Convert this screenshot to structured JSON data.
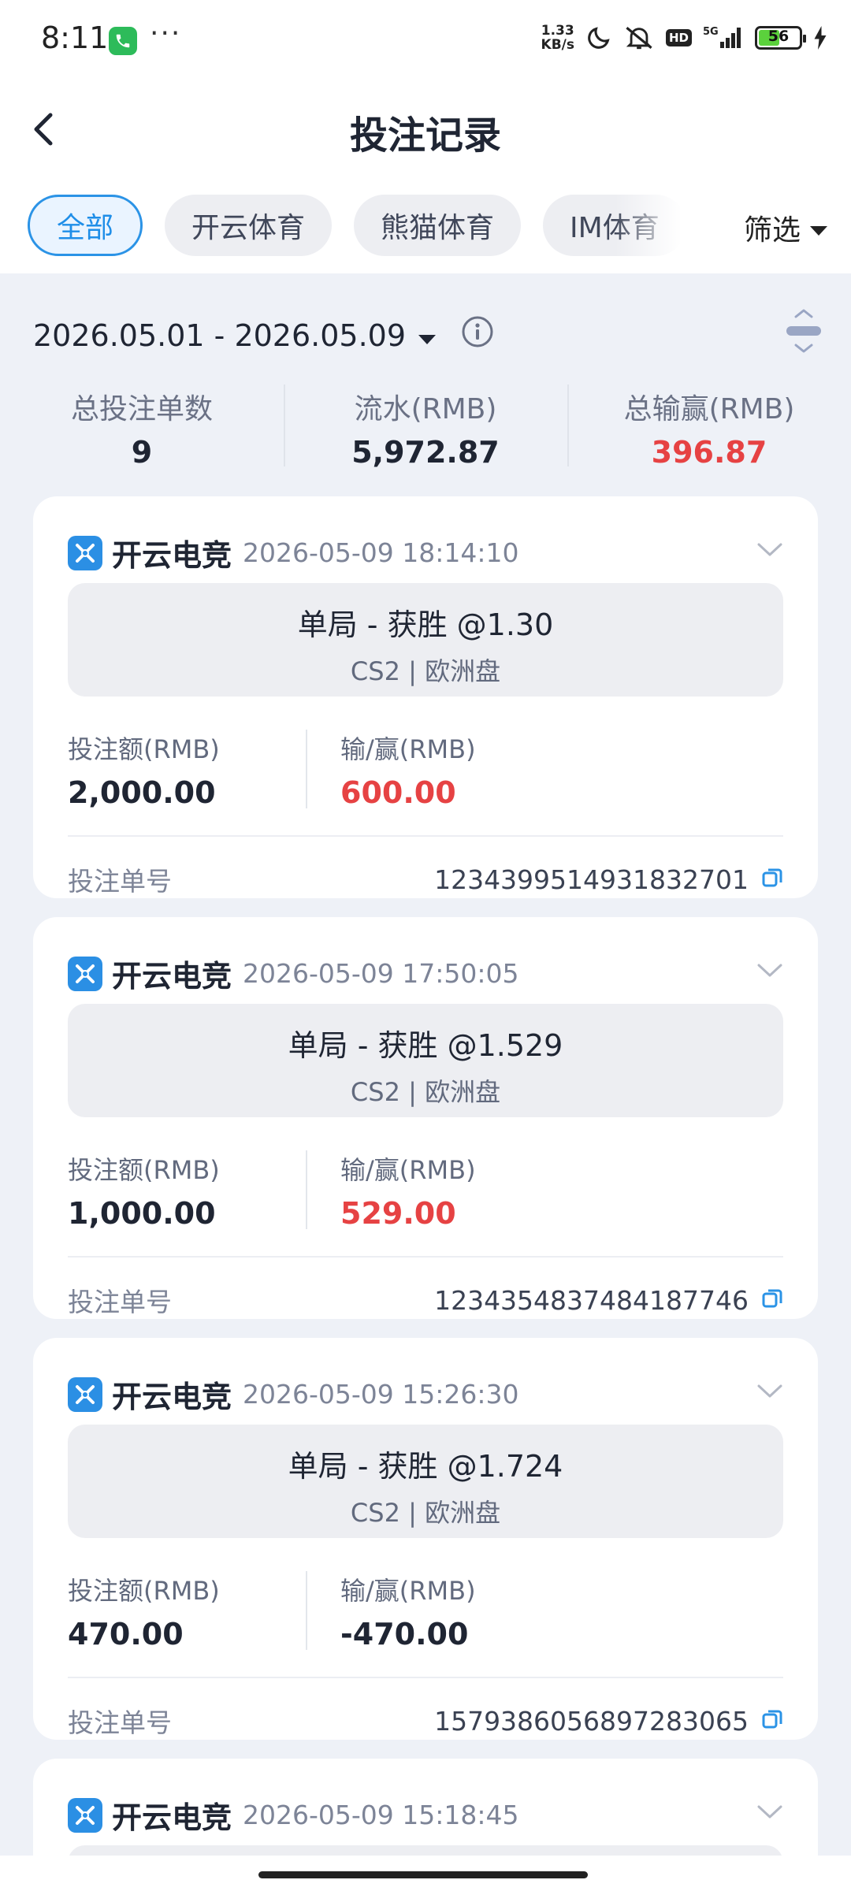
{
  "status_bar": {
    "time": "8:11",
    "dots": "···",
    "net_speed_value": "1.33",
    "net_speed_unit": "KB/s",
    "hd": "HD",
    "battery": "56",
    "battery_level": 0.56
  },
  "header": {
    "title": "投注记录"
  },
  "tabs": [
    {
      "label": "全部",
      "active": true
    },
    {
      "label": "开云体育",
      "active": false
    },
    {
      "label": "熊猫体育",
      "active": false
    },
    {
      "label": "IM体育",
      "active": false
    }
  ],
  "filter": {
    "label": "筛选"
  },
  "date_range": "2026.05.01 - 2026.05.09",
  "summary": [
    {
      "label": "总投注单数",
      "value": "9"
    },
    {
      "label": "流水(RMB)",
      "value": "5,972.87"
    },
    {
      "label": "总输赢(RMB)",
      "value": "396.87",
      "color": "#e64243"
    }
  ],
  "labels": {
    "stake": "投注额(RMB)",
    "win_loss": "输/赢(RMB)",
    "order_no": "投注单号"
  },
  "colors": {
    "accent": "#2b93e6",
    "win": "#e64243"
  },
  "bets": [
    {
      "platform": "开云电竞",
      "time": "2026-05-09 18:14:10",
      "selection": "单局 - 获胜 @1.30",
      "game": "CS2 | 欧洲盘",
      "stake": "2,000.00",
      "result": "600.00",
      "is_win": true,
      "order_no": "1234399514931832701"
    },
    {
      "platform": "开云电竞",
      "time": "2026-05-09 17:50:05",
      "selection": "单局 - 获胜 @1.529",
      "game": "CS2 | 欧洲盘",
      "stake": "1,000.00",
      "result": "529.00",
      "is_win": true,
      "order_no": "1234354837484187746"
    },
    {
      "platform": "开云电竞",
      "time": "2026-05-09 15:26:30",
      "selection": "单局 - 获胜 @1.724",
      "game": "CS2 | 欧洲盘",
      "stake": "470.00",
      "result": "-470.00",
      "is_win": false,
      "order_no": "1579386056897283065"
    },
    {
      "platform": "开云电竞",
      "time": "2026-05-09 15:18:45"
    }
  ]
}
